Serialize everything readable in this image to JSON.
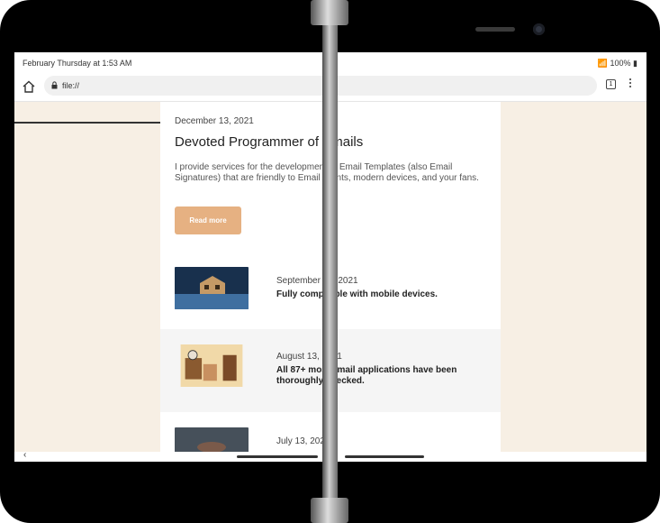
{
  "status": {
    "datetime": "February Thursday at 1:53 AM",
    "battery": "100%"
  },
  "browser": {
    "url": "file://",
    "tab_count": "1"
  },
  "featured": {
    "date": "December 13, 2021",
    "title": "Devoted Programmer of Emails",
    "description": "I provide services for the development of Email Templates (also Email Signatures) that are friendly to Email clients, modern devices, and your fans.",
    "button": "Read more"
  },
  "articles": [
    {
      "date": "September 13, 2021",
      "title": "Fully compatible with mobile devices."
    },
    {
      "date": "August 13, 2021",
      "title": "All 87+ most email applications have been thoroughly checked."
    },
    {
      "date": "July 13, 2021",
      "title": ""
    }
  ],
  "colors": {
    "page_background": "#f7efe4",
    "accent": "#e6b182",
    "card": "#ffffff",
    "alt_row": "#f5f5f5"
  }
}
